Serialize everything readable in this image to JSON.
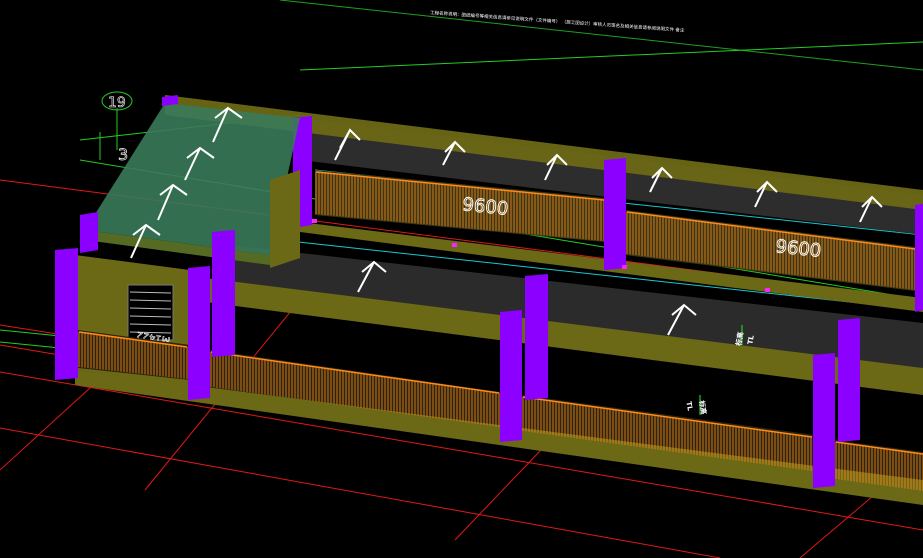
{
  "window": {
    "title": ""
  },
  "drawing": {
    "header_note": "工程名称说明：图纸编号等相关信息请参见说明文件（文件编号）   （施工图设计）审核人员签名及相关信息请参阅说明文件  备注",
    "axis_bubble": "19",
    "axis_partial": "3",
    "dimension_label_1": "9600",
    "dimension_label_2": "9600",
    "door_label": "M1422",
    "level_tag_1": "标高",
    "level_tag_2": "标高",
    "level_tag_letter_1": "TL",
    "level_tag_letter_2": "TL"
  },
  "colors": {
    "background": "#000000",
    "column": "#8b00ff",
    "beam": "#6e6a16",
    "slab": "#2e2e2e",
    "railing": "#ff8a1e",
    "grid": "#ff2020",
    "axis": "#22cc22",
    "guide": "#18d0d0",
    "stair_slab": "#3a7a5a"
  },
  "icons": {
    "slab_direction": "arrow-up-icon",
    "level_marker": "level-arrow-icon"
  }
}
